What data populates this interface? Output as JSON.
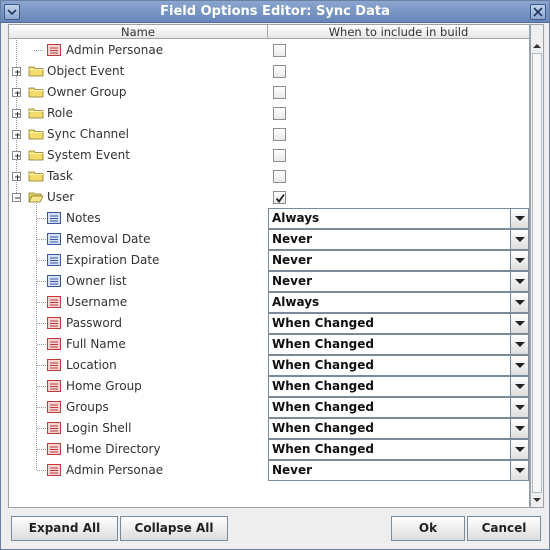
{
  "window": {
    "title": "Field Options Editor: Sync Data"
  },
  "table": {
    "headers": {
      "name": "Name",
      "when": "When to include in build"
    },
    "tree_rows": [
      {
        "label": "Admin Personae",
        "type": "field-leaf",
        "checked": false
      },
      {
        "label": "Object Event",
        "type": "folder",
        "checked": false
      },
      {
        "label": "Owner Group",
        "type": "folder",
        "checked": false
      },
      {
        "label": "Role",
        "type": "folder",
        "checked": false
      },
      {
        "label": "Sync Channel",
        "type": "folder",
        "checked": false
      },
      {
        "label": "System Event",
        "type": "folder",
        "checked": false
      },
      {
        "label": "Task",
        "type": "folder",
        "checked": false
      },
      {
        "label": "User",
        "type": "folder-open",
        "checked": true
      }
    ],
    "user_fields": [
      {
        "label": "Notes",
        "icon": "blue-field-icon",
        "value": "Always"
      },
      {
        "label": "Removal Date",
        "icon": "blue-field-icon",
        "value": "Never"
      },
      {
        "label": "Expiration Date",
        "icon": "blue-field-icon",
        "value": "Never"
      },
      {
        "label": "Owner list",
        "icon": "blue-field-icon",
        "value": "Never"
      },
      {
        "label": "Username",
        "icon": "red-field-icon",
        "value": "Always"
      },
      {
        "label": "Password",
        "icon": "red-field-icon",
        "value": "When Changed"
      },
      {
        "label": "Full Name",
        "icon": "red-field-icon",
        "value": "When Changed"
      },
      {
        "label": "Location",
        "icon": "red-field-icon",
        "value": "When Changed"
      },
      {
        "label": "Home Group",
        "icon": "red-field-icon",
        "value": "When Changed"
      },
      {
        "label": "Groups",
        "icon": "red-field-icon",
        "value": "When Changed"
      },
      {
        "label": "Login Shell",
        "icon": "red-field-icon",
        "value": "When Changed"
      },
      {
        "label": "Home Directory",
        "icon": "red-field-icon",
        "value": "When Changed"
      },
      {
        "label": "Admin Personae",
        "icon": "red-field-icon",
        "value": "Never"
      }
    ]
  },
  "buttons": {
    "expand_all": "Expand All",
    "collapse_all": "Collapse All",
    "ok": "Ok",
    "cancel": "Cancel"
  }
}
